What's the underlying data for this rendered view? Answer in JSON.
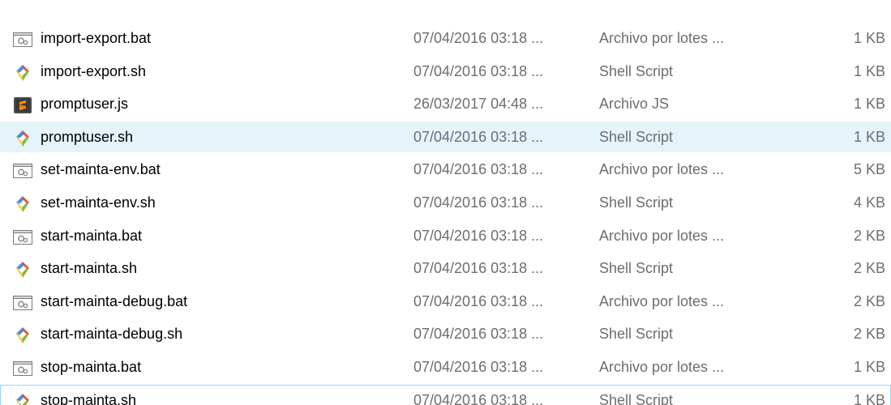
{
  "files": [
    {
      "name": "import-export.bat",
      "date": "07/04/2016 03:18 ...",
      "type": "Archivo por lotes ...",
      "size": "1 KB",
      "icon": "batch-file-icon"
    },
    {
      "name": "import-export.sh",
      "date": "07/04/2016 03:18 ...",
      "type": "Shell Script",
      "size": "1 KB",
      "icon": "git-shell-script-icon"
    },
    {
      "name": "promptuser.js",
      "date": "26/03/2017 04:48 ...",
      "type": "Archivo JS",
      "size": "1 KB",
      "icon": "sublime-js-file-icon"
    },
    {
      "name": "promptuser.sh",
      "date": "07/04/2016 03:18 ...",
      "type": "Shell Script",
      "size": "1 KB",
      "icon": "git-shell-script-icon",
      "state": "hover"
    },
    {
      "name": "set-mainta-env.bat",
      "date": "07/04/2016 03:18 ...",
      "type": "Archivo por lotes ...",
      "size": "5 KB",
      "icon": "batch-file-icon"
    },
    {
      "name": "set-mainta-env.sh",
      "date": "07/04/2016 03:18 ...",
      "type": "Shell Script",
      "size": "4 KB",
      "icon": "git-shell-script-icon"
    },
    {
      "name": "start-mainta.bat",
      "date": "07/04/2016 03:18 ...",
      "type": "Archivo por lotes ...",
      "size": "2 KB",
      "icon": "batch-file-icon"
    },
    {
      "name": "start-mainta.sh",
      "date": "07/04/2016 03:18 ...",
      "type": "Shell Script",
      "size": "2 KB",
      "icon": "git-shell-script-icon"
    },
    {
      "name": "start-mainta-debug.bat",
      "date": "07/04/2016 03:18 ...",
      "type": "Archivo por lotes ...",
      "size": "2 KB",
      "icon": "batch-file-icon"
    },
    {
      "name": "start-mainta-debug.sh",
      "date": "07/04/2016 03:18 ...",
      "type": "Shell Script",
      "size": "2 KB",
      "icon": "git-shell-script-icon"
    },
    {
      "name": "stop-mainta.bat",
      "date": "07/04/2016 03:18 ...",
      "type": "Archivo por lotes ...",
      "size": "1 KB",
      "icon": "batch-file-icon"
    },
    {
      "name": "stop-mainta.sh",
      "date": "07/04/2016 03:18 ...",
      "type": "Shell Script",
      "size": "1 KB",
      "icon": "git-shell-script-icon",
      "state": "focused"
    }
  ],
  "colors": {
    "hover_background": "#e5f3fb",
    "focus_border": "#99d1ff",
    "secondary_text": "#6d6d6d",
    "git_red": "#e84d31",
    "git_blue": "#4a90d9",
    "git_green": "#7cbb3c",
    "git_yellow": "#f5c342"
  }
}
